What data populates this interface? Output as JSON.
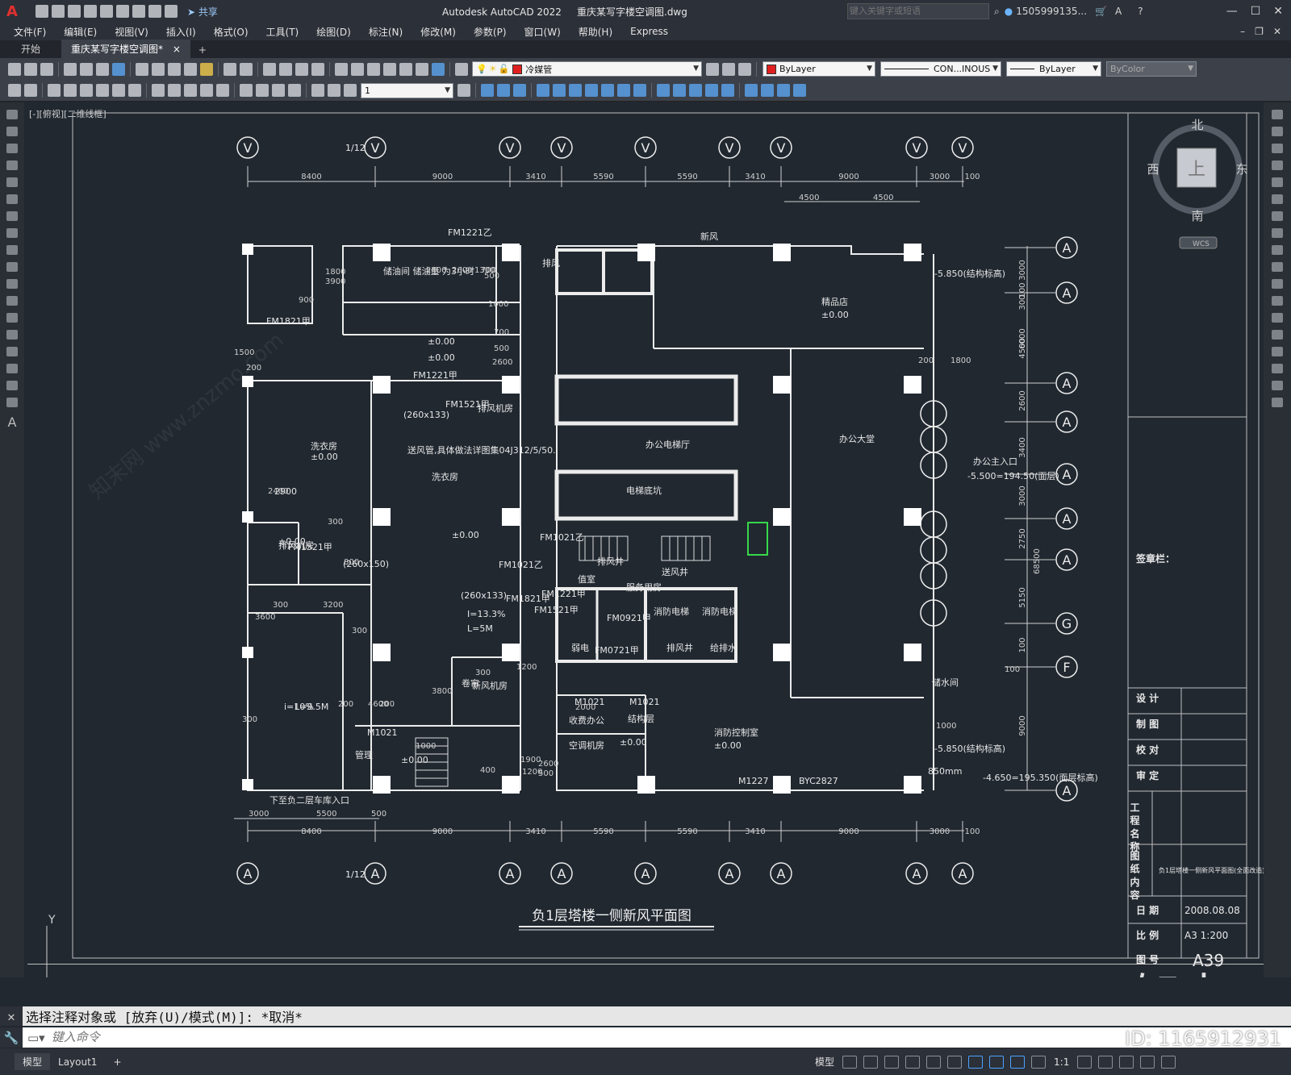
{
  "title_bar": {
    "app_title": "Autodesk AutoCAD 2022",
    "file_name": "重庆某写字楼空调图.dwg",
    "share_label": "共享",
    "search_placeholder": "键入关键字或短语",
    "user_name": "1505999135..."
  },
  "menu": [
    "文件(F)",
    "编辑(E)",
    "视图(V)",
    "插入(I)",
    "格式(O)",
    "工具(T)",
    "绘图(D)",
    "标注(N)",
    "修改(M)",
    "参数(P)",
    "窗口(W)",
    "帮助(H)",
    "Express"
  ],
  "file_tabs": {
    "start": "开始",
    "active": "重庆某写字楼空调图*",
    "close": "×",
    "add": "+"
  },
  "properties": {
    "layer": "冷媒管",
    "color": "ByLayer",
    "linetype": "CON...INOUS",
    "lineweight": "ByLayer",
    "plotstyle": "ByColor",
    "scale_value": "1",
    "layer_color": "#e02020",
    "color_swatch": "#e02020"
  },
  "viewport_label": "[-][俯视][二维线框]",
  "viewcube": {
    "north": "北",
    "south": "南",
    "east": "东",
    "west": "西",
    "top": "上",
    "wcs": "WCS"
  },
  "drawing": {
    "title": "负1层塔楼一侧新风平面图",
    "top_dims": [
      "8400",
      "9000",
      "3410",
      "5590",
      "5590",
      "3410",
      "9000",
      "3000",
      "100"
    ],
    "sub_dims": [
      "4500",
      "4500"
    ],
    "bottom_dims": [
      "8400",
      "9000",
      "3410",
      "5590",
      "5590",
      "3410",
      "9000",
      "3000",
      "100"
    ],
    "bottom_dims_lower": [
      "3000",
      "5500",
      "500"
    ],
    "right_dims": [
      "3000",
      "100",
      "300",
      "4500",
      "6000",
      "2600",
      "3400",
      "3000",
      "2750",
      "5150",
      "100",
      "9000"
    ],
    "right_dim_total": "68500",
    "axis_top": [
      "V",
      "V",
      "V",
      "V",
      "V",
      "V",
      "V",
      "V",
      "V"
    ],
    "axis_top_fraction": "1/12",
    "axis_bottom": [
      "A",
      "A",
      "A",
      "A",
      "A",
      "A",
      "A",
      "A",
      "A"
    ],
    "axis_right": [
      "A",
      "A",
      "A",
      "A",
      "A",
      "A",
      "A",
      "G",
      "F",
      "A"
    ],
    "rooms": [
      "储油间 储油量 为3小时",
      "FM1221乙",
      "排风",
      "新风",
      "精品店",
      "±0.00",
      "FM1821甲",
      "±0.00",
      "±0.00",
      "FM1221甲",
      "(260x133)",
      "FM1521甲",
      "排风机房",
      "办公电梯厅",
      "办公大堂",
      "洗衣房",
      "±0.00",
      "洗衣房",
      "±0.00",
      "送风管,具体做法详图集04J312/5/50.",
      "2900",
      "FM1521甲",
      "排风机房",
      "(260x150)",
      "±0.00",
      "电梯底坑",
      "FM1021乙",
      "FM1021乙",
      "(260x133)",
      "FM1821甲",
      "FM1221甲",
      "I=13.3%",
      "L=5M",
      "FM1521甲",
      "FM0921甲",
      "FM0721甲",
      "消防电梯",
      "消防电梯",
      "送风井",
      "排风井",
      "给排水",
      "值室",
      "弱电",
      "服务用房",
      "卷帘",
      "新风机房",
      "M1021",
      "M1021",
      "M1021",
      "收费办公",
      "结构层",
      "空调机房",
      "±0.00",
      "消防控制室",
      "±0.00",
      "M1227",
      "BYC2827",
      "储水间",
      "下至负二层车库入口",
      "管理",
      "±0.00",
      "排风井",
      "-5.850(结构标高)",
      "-5.850(结构标高)",
      "办公主入口",
      "-5.500=194.50(面层)",
      "-4.650=195.350(面层标高)",
      "850mm",
      "i=10%",
      "L=9.5M"
    ],
    "misc_dims": [
      "900",
      "1800",
      "3900",
      "2400",
      "2600",
      "1300",
      "700",
      "500",
      "1000",
      "700",
      "500",
      "2600",
      "1500",
      "200",
      "2400",
      "300",
      "800",
      "300",
      "3200",
      "3600",
      "300",
      "300",
      "1200",
      "3800",
      "200",
      "4600",
      "200",
      "1000",
      "400",
      "2000",
      "1900",
      "2600",
      "1200",
      "500",
      "200",
      "1800",
      "1000",
      "100",
      "300"
    ]
  },
  "title_block": {
    "stamp": "签章栏：",
    "design": "设 计",
    "drawn": "制 图",
    "check": "校 对",
    "approve": "审 定",
    "project_name": "工 程 名 称",
    "drawing_content": "图 纸 内 容",
    "content_value": "负1层塔楼一侧新风平面图(全面改造)",
    "date_label": "日 期",
    "date_value": "2008.08.08",
    "scale_label": "比 例",
    "scale_value": "A3  1:200",
    "sheet_label": "图 号",
    "sheet_value": "A39"
  },
  "command_line": {
    "last": "选择注释对象或 [放弃(U)/模式(M)]: *取消*",
    "placeholder": "键入命令"
  },
  "layout_tabs": [
    "模型",
    "Layout1",
    "+"
  ],
  "status_bar": {
    "model_label": "模型",
    "scale": "1:1"
  },
  "watermark": {
    "brand": "知末",
    "id": "ID: 1165912931",
    "site": "知末网 www.znzmo.com"
  }
}
